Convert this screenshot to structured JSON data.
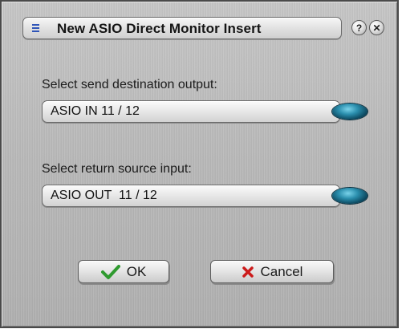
{
  "dialog": {
    "title": "New ASIO Direct Monitor Insert",
    "icons": {
      "menu": "menu-icon",
      "help": "help-icon",
      "close": "close-icon"
    },
    "help_glyph": "?",
    "close_glyph": "✕"
  },
  "send": {
    "label": "Select send destination output:",
    "value": "ASIO IN 11 / 12"
  },
  "return": {
    "label": "Select return source input:",
    "value": "ASIO OUT  11 / 12"
  },
  "buttons": {
    "ok_label": "OK",
    "ok_icon": "checkmark-icon",
    "cancel_label": "Cancel",
    "cancel_icon": "x-icon"
  },
  "colors": {
    "indicator": "#2b8fae",
    "ok_check": "#2f9a2f",
    "cancel_x": "#cc1a1a",
    "menu_icon": "#2f55b8"
  }
}
